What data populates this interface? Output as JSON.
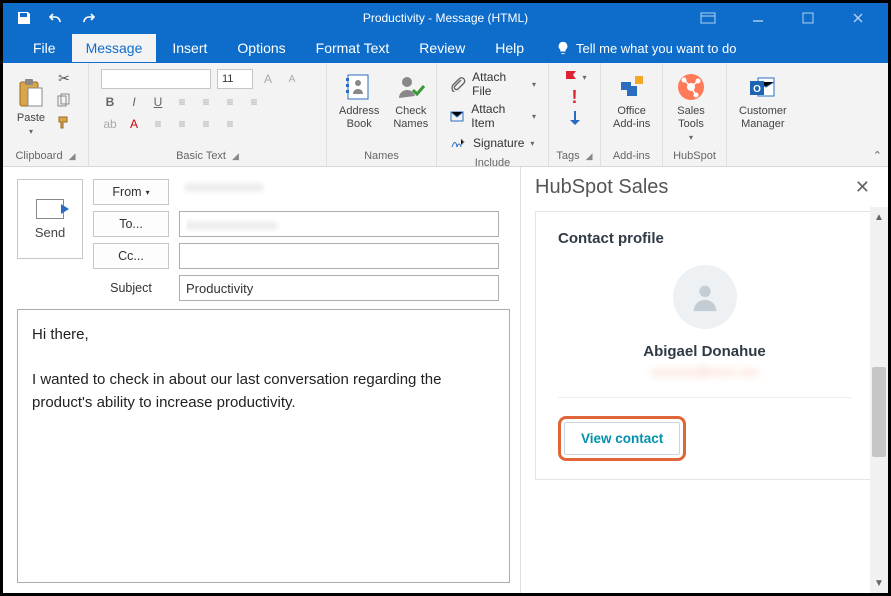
{
  "titlebar": {
    "title": "Productivity  -  Message (HTML)"
  },
  "tabs": {
    "file": "File",
    "message": "Message",
    "insert": "Insert",
    "options": "Options",
    "format_text": "Format Text",
    "review": "Review",
    "help": "Help",
    "tell_me": "Tell me what you want to do"
  },
  "ribbon": {
    "clipboard": {
      "label": "Clipboard",
      "paste": "Paste"
    },
    "basic_text": {
      "label": "Basic Text",
      "font_size": "11"
    },
    "names": {
      "label": "Names",
      "address_book": "Address\nBook",
      "check_names": "Check\nNames"
    },
    "include": {
      "label": "Include",
      "attach_file": "Attach File",
      "attach_item": "Attach Item",
      "signature": "Signature"
    },
    "tags": {
      "label": "Tags"
    },
    "addins": {
      "label": "Add-ins",
      "office": "Office\nAdd-ins"
    },
    "hubspot": {
      "label": "HubSpot",
      "sales_tools": "Sales\nTools"
    },
    "customer": {
      "label": "",
      "manager": "Customer\nManager"
    }
  },
  "compose": {
    "send": "Send",
    "from": "From",
    "to": "To...",
    "cc": "Cc...",
    "subject_label": "Subject",
    "subject_value": "Productivity",
    "body_line1": "Hi there,",
    "body_line2": "I wanted to check in about our last conversation regarding the product's ability to increase productivity."
  },
  "hubspot_pane": {
    "title": "HubSpot Sales",
    "card_title": "Contact profile",
    "contact_name": "Abigael Donahue",
    "view_contact": "View contact"
  }
}
